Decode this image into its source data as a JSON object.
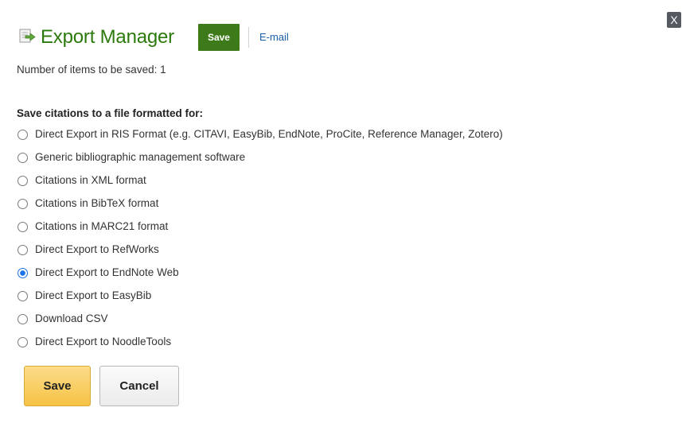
{
  "dialog": {
    "title": "Export Manager",
    "close_label": "X",
    "save_small_label": "Save",
    "email_label": "E-mail",
    "item_count_text": "Number of items to be saved: 1",
    "section_heading": "Save citations to a file formatted for:",
    "options": [
      {
        "label": "Direct Export in RIS Format (e.g. CITAVI, EasyBib, EndNote, ProCite, Reference Manager, Zotero)",
        "selected": false
      },
      {
        "label": "Generic bibliographic management software",
        "selected": false
      },
      {
        "label": "Citations in XML format",
        "selected": false
      },
      {
        "label": "Citations in BibTeX format",
        "selected": false
      },
      {
        "label": "Citations in MARC21 format",
        "selected": false
      },
      {
        "label": "Direct Export to RefWorks",
        "selected": false
      },
      {
        "label": "Direct Export to EndNote Web",
        "selected": true
      },
      {
        "label": "Direct Export to EasyBib",
        "selected": false
      },
      {
        "label": "Download CSV",
        "selected": false
      },
      {
        "label": "Direct Export to NoodleTools",
        "selected": false
      }
    ],
    "save_button_label": "Save",
    "cancel_button_label": "Cancel"
  },
  "icons": {
    "title_icon": "export-document-arrow-icon"
  },
  "colors": {
    "title_green": "#2b7a0b",
    "small_save_bg": "#3c7a1a",
    "link_blue": "#1a5ea8",
    "radio_selected": "#1a73e8",
    "primary_button": "#f5c244"
  }
}
